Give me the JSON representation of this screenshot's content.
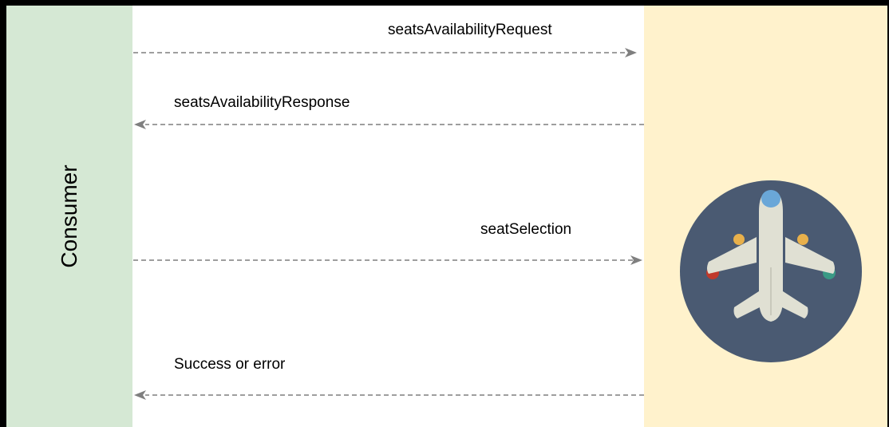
{
  "lanes": {
    "consumer": {
      "label": "Consumer",
      "color": "#d5e8d4"
    },
    "provider": {
      "color": "#fff2cc",
      "icon": "airplane-icon"
    }
  },
  "messages": [
    {
      "label": "seatsAvailabilityRequest",
      "direction": "to-provider"
    },
    {
      "label": "seatsAvailabilityResponse",
      "direction": "to-consumer"
    },
    {
      "label": "seatSelection",
      "direction": "to-provider"
    },
    {
      "label": "Success or error",
      "direction": "to-consumer"
    }
  ],
  "colors": {
    "arrow": "#7f7f7f",
    "icon_circle": "#4a5a72",
    "plane_body": "#e0e0d3"
  }
}
